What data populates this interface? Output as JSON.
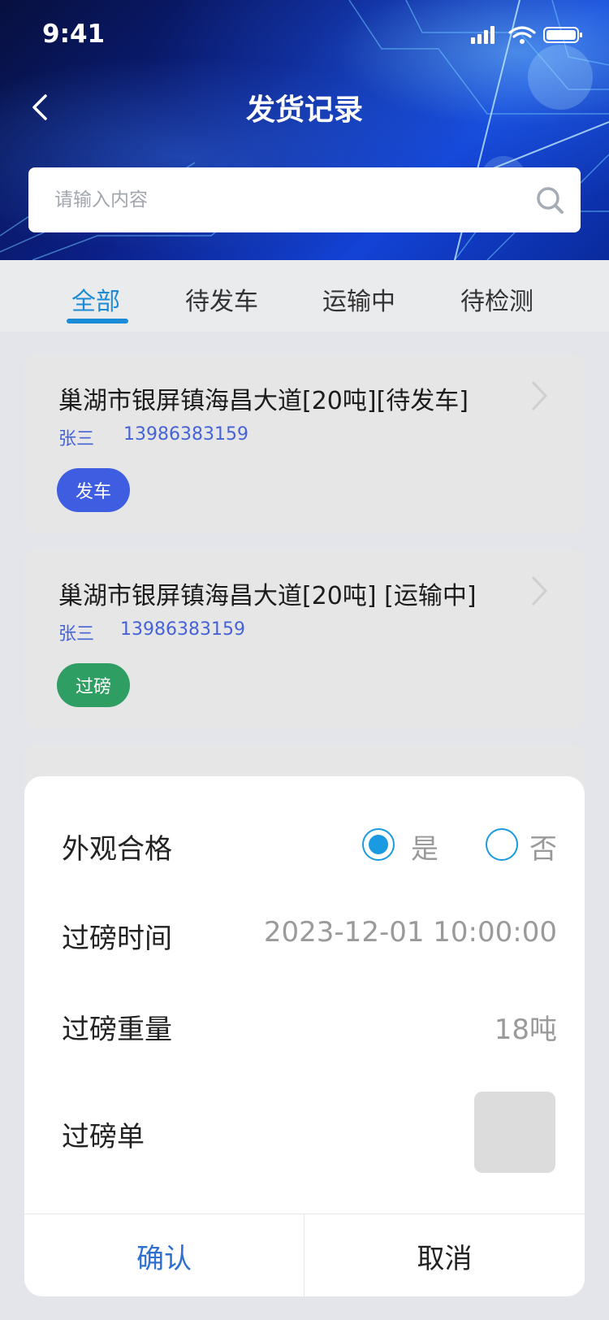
{
  "status_bar": {
    "time": "9:41"
  },
  "header": {
    "title": "发货记录"
  },
  "search": {
    "placeholder": "请输入内容"
  },
  "tabs": [
    {
      "label": "全部",
      "active": true
    },
    {
      "label": "待发车",
      "active": false
    },
    {
      "label": "运输中",
      "active": false
    },
    {
      "label": "待检测",
      "active": false
    }
  ],
  "records": [
    {
      "title": "巢湖市银屏镇海昌大道[20吨][待发车]",
      "name": "张三",
      "phone": "13986383159",
      "action": "发车",
      "action_color": "#3e5de0"
    },
    {
      "title": "巢湖市银屏镇海昌大道[20吨] [运输中]",
      "name": "张三",
      "phone": "13986383159",
      "action": "过磅",
      "action_color": "#2f9e62"
    }
  ],
  "dialog": {
    "appearance_label": "外观合格",
    "option_yes": "是",
    "option_no": "否",
    "selected": "是",
    "weigh_time_label": "过磅时间",
    "weigh_time_value": "2023-12-01 10:00:00",
    "weight_label": "过磅重量",
    "weight_value": "18吨",
    "slip_label": "过磅单",
    "confirm_label": "确认",
    "cancel_label": "取消"
  },
  "colors": {
    "accent": "#1a8bd6",
    "link_blue": "#4663d6",
    "confirm_blue": "#2e6fd1"
  }
}
